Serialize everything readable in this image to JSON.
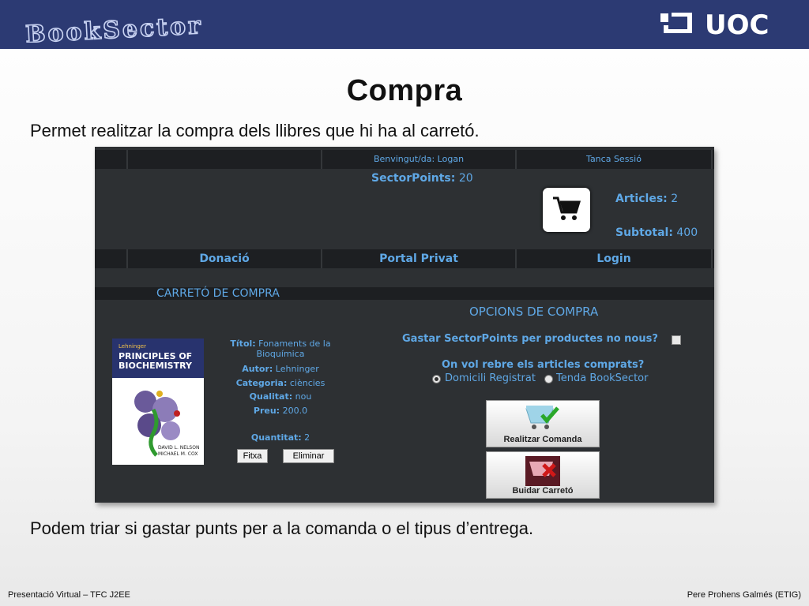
{
  "header": {
    "brand_logo_text": "BookSector",
    "uoc_logo_text": "UOC"
  },
  "slide": {
    "title": "Compra",
    "intro": "Permet realitzar la compra dels llibres que hi ha al carretó.",
    "outro": "Podem triar si gastar punts per a la comanda o el tipus d’entrega.",
    "footer_left": "Presentació Virtual – TFC J2EE",
    "footer_right": "Pere Prohens Galmés (ETIG)"
  },
  "app": {
    "welcome": "Benvingut/da: Logan",
    "logout": "Tanca Sessió",
    "points_label": "SectorPoints:",
    "points_value": "20",
    "articles_label": "Articles:",
    "articles_value": "2",
    "subtotal_label": "Subtotal:",
    "subtotal_value": "400",
    "nav": [
      "Donació",
      "Portal Privat",
      "Login"
    ],
    "cart_title": "CARRETÓ DE COMPRA",
    "book": {
      "cover_publisher": "Lehninger",
      "cover_title": "PRINCIPLES OF BIOCHEMISTRY",
      "cover_authors": "DAVID L. NELSON MICHAEL M. COX",
      "title_label": "Títol:",
      "title_value": "Fonaments de la Bioquímica",
      "author_label": "Autor:",
      "author_value": "Lehninger",
      "category_label": "Categoria:",
      "category_value": "ciències",
      "quality_label": "Qualitat:",
      "quality_value": "nou",
      "price_label": "Preu:",
      "price_value": "200.0",
      "quantity_label": "Quantitat:",
      "quantity_value": "2"
    },
    "fitxa_button": "Fitxa",
    "eliminar_button": "Eliminar",
    "options_title": "OPCIONS DE COMPRA",
    "spend_points_question": "Gastar SectorPoints per productes no nous?",
    "spend_points_checked": false,
    "delivery_question": "On vol rebre els articles comprats?",
    "delivery_options": [
      "Domicili Registrat",
      "Tenda BookSector"
    ],
    "delivery_selected": "Domicili Registrat",
    "order_button": "Realitzar Comanda",
    "empty_button": "Buidar Carretó"
  },
  "colors": {
    "banner": "#2c3a73",
    "app_bg": "#2d3033",
    "app_bar": "#1d1f22",
    "link_blue": "#5fa8e6"
  },
  "icons": [
    "cart-icon",
    "cart-check-icon",
    "cart-remove-icon",
    "uoc-logo-icon",
    "book-cover"
  ]
}
